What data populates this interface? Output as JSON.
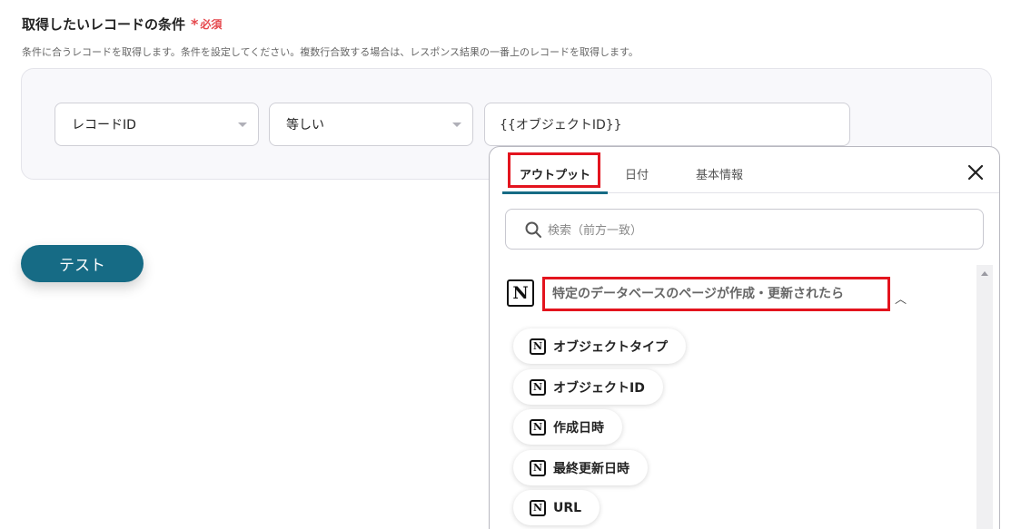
{
  "section": {
    "title": "取得したいレコードの条件",
    "required_mark": "*",
    "required_label": "必須",
    "description": "条件に合うレコードを取得します。条件を設定してください。複数行合致する場合は、レスポンス結果の一番上のレコードを取得します。"
  },
  "condition": {
    "field_value": "レコードID",
    "operator_value": "等しい",
    "input_value": "{{オブジェクトID}}"
  },
  "test_button": "テスト",
  "panel": {
    "tabs": [
      "アウトプット",
      "日付",
      "基本情報"
    ],
    "active_tab": "アウトプット",
    "search_placeholder": "検索（前方一致）",
    "group_title": "特定のデータベースのページが作成・更新されたら",
    "items": [
      "オブジェクトタイプ",
      "オブジェクトID",
      "作成日時",
      "最終更新日時",
      "URL"
    ]
  },
  "icons": {
    "group": "notion-icon",
    "item": "notion-icon",
    "close": "close-icon",
    "search": "search-icon",
    "collapse": "chevron-up-icon"
  },
  "colors": {
    "accent": "#166b85",
    "required": "#e5484d",
    "highlight": "#e3141e"
  }
}
